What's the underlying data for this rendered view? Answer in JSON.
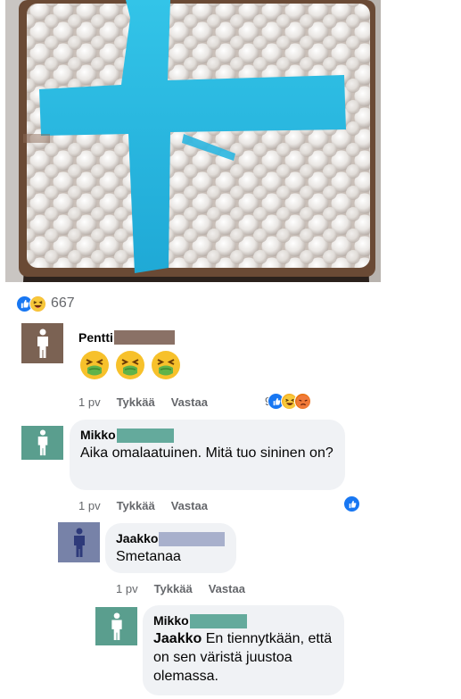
{
  "post": {
    "reactions": {
      "icons": [
        "like-icon",
        "haha-icon"
      ],
      "count": "667"
    }
  },
  "comments": [
    {
      "author": "Pentti",
      "text": "",
      "emoji": [
        "nauseated-face-emoji",
        "nauseated-face-emoji",
        "nauseated-face-emoji"
      ],
      "age": "1 pv",
      "like_label": "Tykkää",
      "reply_label": "Vastaa",
      "reaction_count": "9",
      "reaction_icons": [
        "like-icon",
        "haha-icon",
        "angry-icon"
      ],
      "avatar_color": "#7b6253"
    },
    {
      "author": "Mikko",
      "text": "Aika omalaatuinen. Mitä tuo sininen on?",
      "age": "1 pv",
      "like_label": "Tykkää",
      "reply_label": "Vastaa",
      "reaction_icons": [
        "like-icon"
      ],
      "avatar_color": "#5a9e8e"
    },
    {
      "author": "Jaakko",
      "text": "Smetanaa",
      "age": "1 pv",
      "like_label": "Tykkää",
      "reply_label": "Vastaa",
      "avatar_color": "#7782a8"
    },
    {
      "author": "Mikko",
      "mention": "Jaakko",
      "text": "En tiennytkään, että on sen väristä juustoa olemassa.",
      "avatar_color": "#5a9e8e"
    }
  ],
  "colors": {
    "redact_brown": "#8a7166",
    "redact_teal": "#64aa9c",
    "redact_lavender": "#a8b0cc",
    "like_blue": "#1877f2"
  }
}
